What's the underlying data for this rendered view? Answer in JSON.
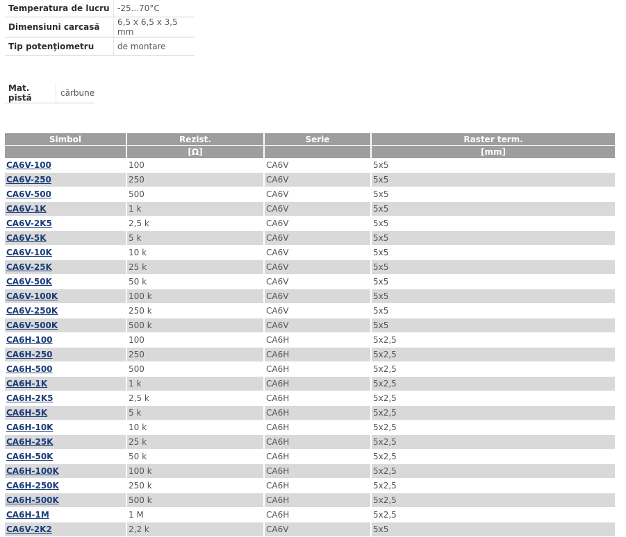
{
  "specs": [
    {
      "label": "Temperatura de lucru",
      "value": "-25...70°C"
    },
    {
      "label": "Dimensiuni carcasă",
      "value": "6,5 x 6,5 x 3,5 mm"
    },
    {
      "label": "Tip potenţiometru",
      "value": "de montare"
    }
  ],
  "material": {
    "label": "Mat. pistă",
    "value": "cărbune"
  },
  "table": {
    "headers": [
      "Simbol",
      "Rezist.",
      "Serie",
      "Raster term."
    ],
    "units": [
      "",
      "[Ω]",
      "",
      "[mm]"
    ],
    "rows": [
      [
        "CA6V-100",
        "100",
        "CA6V",
        "5x5"
      ],
      [
        "CA6V-250",
        "250",
        "CA6V",
        "5x5"
      ],
      [
        "CA6V-500",
        "500",
        "CA6V",
        "5x5"
      ],
      [
        "CA6V-1K",
        "1 k",
        "CA6V",
        "5x5"
      ],
      [
        "CA6V-2K5",
        "2,5 k",
        "CA6V",
        "5x5"
      ],
      [
        "CA6V-5K",
        "5 k",
        "CA6V",
        "5x5"
      ],
      [
        "CA6V-10K",
        "10 k",
        "CA6V",
        "5x5"
      ],
      [
        "CA6V-25K",
        "25 k",
        "CA6V",
        "5x5"
      ],
      [
        "CA6V-50K",
        "50 k",
        "CA6V",
        "5x5"
      ],
      [
        "CA6V-100K",
        "100 k",
        "CA6V",
        "5x5"
      ],
      [
        "CA6V-250K",
        "250 k",
        "CA6V",
        "5x5"
      ],
      [
        "CA6V-500K",
        "500 k",
        "CA6V",
        "5x5"
      ],
      [
        "CA6H-100",
        "100",
        "CA6H",
        "5x2,5"
      ],
      [
        "CA6H-250",
        "250",
        "CA6H",
        "5x2,5"
      ],
      [
        "CA6H-500",
        "500",
        "CA6H",
        "5x2,5"
      ],
      [
        "CA6H-1K",
        "1 k",
        "CA6H",
        "5x2,5"
      ],
      [
        "CA6H-2K5",
        "2,5 k",
        "CA6H",
        "5x2,5"
      ],
      [
        "CA6H-5K",
        "5 k",
        "CA6H",
        "5x2,5"
      ],
      [
        "CA6H-10K",
        "10 k",
        "CA6H",
        "5x2,5"
      ],
      [
        "CA6H-25K",
        "25 k",
        "CA6H",
        "5x2,5"
      ],
      [
        "CA6H-50K",
        "50 k",
        "CA6H",
        "5x2,5"
      ],
      [
        "CA6H-100K",
        "100 k",
        "CA6H",
        "5x2,5"
      ],
      [
        "CA6H-250K",
        "250 k",
        "CA6H",
        "5x2,5"
      ],
      [
        "CA6H-500K",
        "500 k",
        "CA6H",
        "5x2,5"
      ],
      [
        "CA6H-1M",
        "1 M",
        "CA6H",
        "5x2,5"
      ],
      [
        "CA6V-2K2",
        "2,2 k",
        "CA6V",
        "5x5"
      ]
    ]
  }
}
